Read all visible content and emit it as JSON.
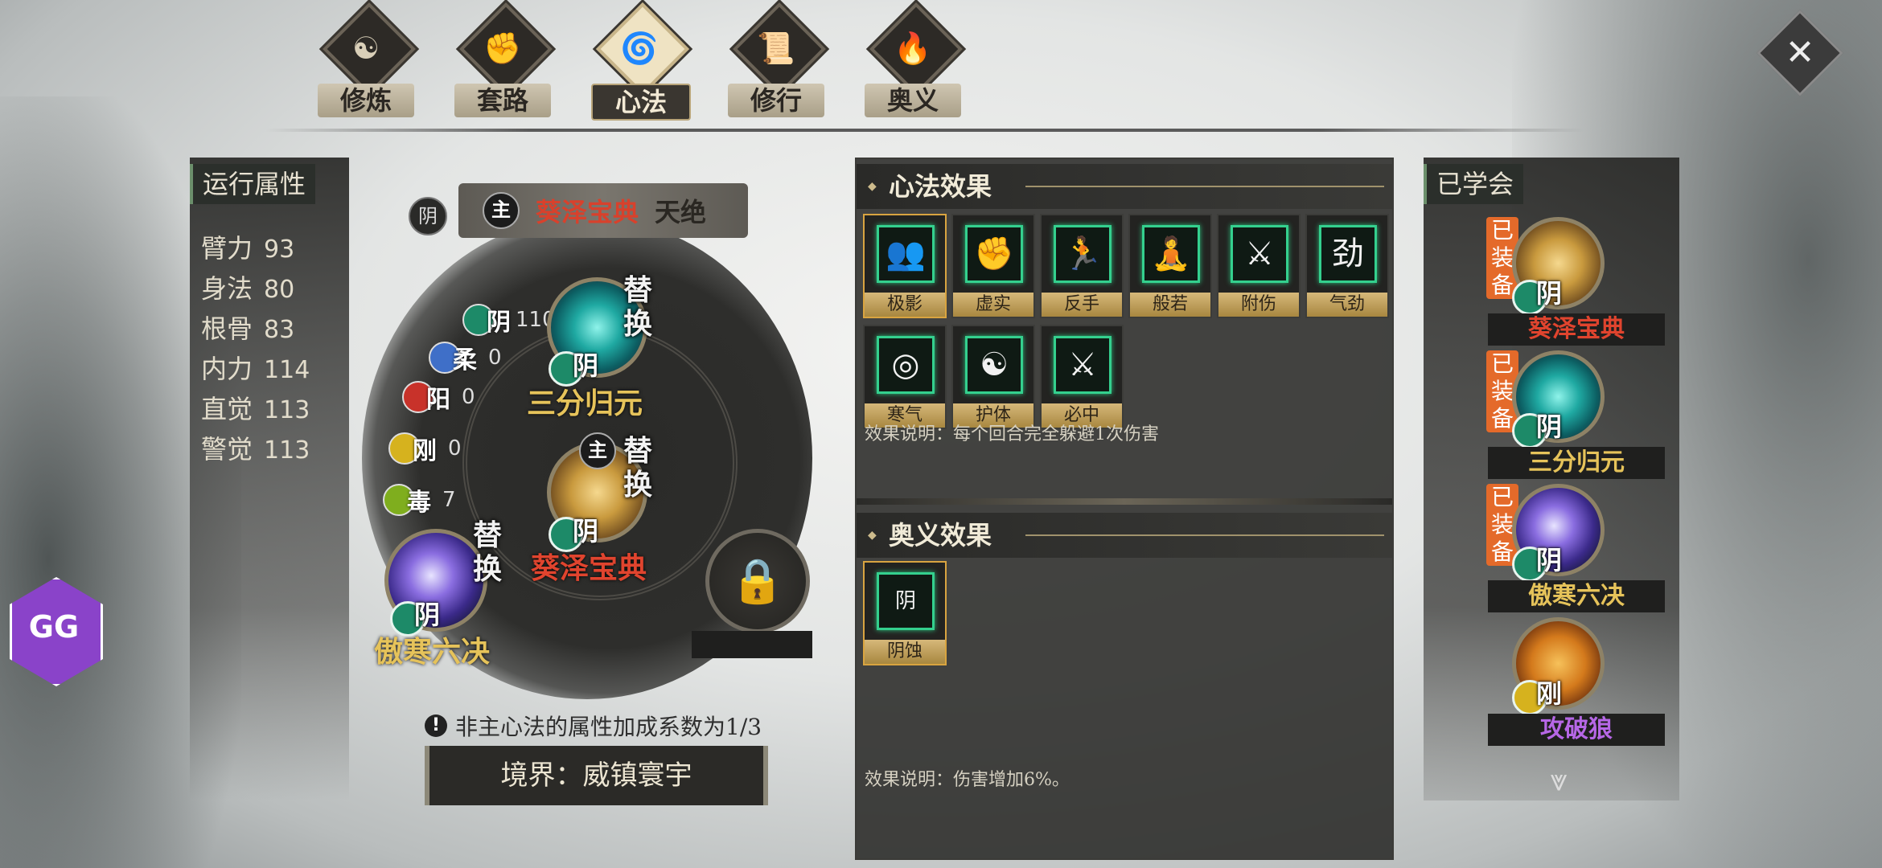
{
  "tabs": [
    {
      "label": "修炼",
      "icon": "cultivate-icon",
      "active": false
    },
    {
      "label": "套路",
      "icon": "fist-icon",
      "active": false
    },
    {
      "label": "心法",
      "icon": "mind-method-icon",
      "active": true
    },
    {
      "label": "修行",
      "icon": "scroll-icon",
      "active": false
    },
    {
      "label": "奥义",
      "icon": "flame-icon",
      "active": false
    }
  ],
  "attributes": {
    "header": "运行属性",
    "items": [
      {
        "name": "臂力",
        "value": "93"
      },
      {
        "name": "身法",
        "value": "80"
      },
      {
        "name": "根骨",
        "value": "83"
      },
      {
        "name": "内力",
        "value": "114"
      },
      {
        "name": "直觉",
        "value": "113"
      },
      {
        "name": "警觉",
        "value": "113"
      }
    ]
  },
  "main_method": {
    "yin_tag": "阴",
    "main_tag": "主",
    "name": "葵泽宝典",
    "tier": "天绝"
  },
  "elements": [
    {
      "char": "阴",
      "value": "110",
      "color": "#1d8a68"
    },
    {
      "char": "柔",
      "value": "0",
      "color": "#3f6fc8"
    },
    {
      "char": "阳",
      "value": "0",
      "color": "#c8322a"
    },
    {
      "char": "刚",
      "value": "0",
      "color": "#d6b21e"
    },
    {
      "char": "毒",
      "value": "7",
      "color": "#7fae1e"
    }
  ],
  "slots": {
    "top": {
      "name": "三分归元",
      "badge": "阴",
      "swap": "替换"
    },
    "center": {
      "name": "葵泽宝典",
      "badge": "阴",
      "swap": "替换",
      "main": "主"
    },
    "left": {
      "name": "傲寒六决",
      "badge": "阴",
      "swap": "替换"
    }
  },
  "note": "非主心法的属性加成系数为1/3",
  "realm": "境界：威镇寰宇",
  "mind_effects": {
    "header": "心法效果",
    "items": [
      {
        "label": "极影",
        "glyph": "👥"
      },
      {
        "label": "虚实",
        "glyph": "✊"
      },
      {
        "label": "反手",
        "glyph": "🏃"
      },
      {
        "label": "般若",
        "glyph": "🧘"
      },
      {
        "label": "附伤",
        "glyph": "⚔"
      },
      {
        "label": "气劲",
        "glyph": "劲"
      },
      {
        "label": "寒气",
        "glyph": "◎"
      },
      {
        "label": "护体",
        "glyph": "☯"
      },
      {
        "label": "必中",
        "glyph": "⚔"
      }
    ],
    "desc": "效果说明：每个回合完全躲避1次伤害"
  },
  "ultimate_effects": {
    "header": "奥义效果",
    "items": [
      {
        "label": "阴蚀",
        "glyph": "阴"
      }
    ],
    "desc": "效果说明：伤害增加6%。"
  },
  "learned": {
    "header": "已学会",
    "equip_tag": "已装备",
    "items": [
      {
        "name": "葵泽宝典",
        "badge": "阴",
        "equipped": true
      },
      {
        "name": "三分归元",
        "badge": "阴",
        "equipped": true
      },
      {
        "name": "傲寒六决",
        "badge": "阴",
        "equipped": true
      },
      {
        "name": "攻破狼",
        "badge": "刚",
        "equipped": false
      }
    ]
  },
  "colors": {
    "accent_green": "#34d08e",
    "selected_border": "#d9a440",
    "red_name": "#e0442e",
    "gold_name": "#e6c35a"
  }
}
